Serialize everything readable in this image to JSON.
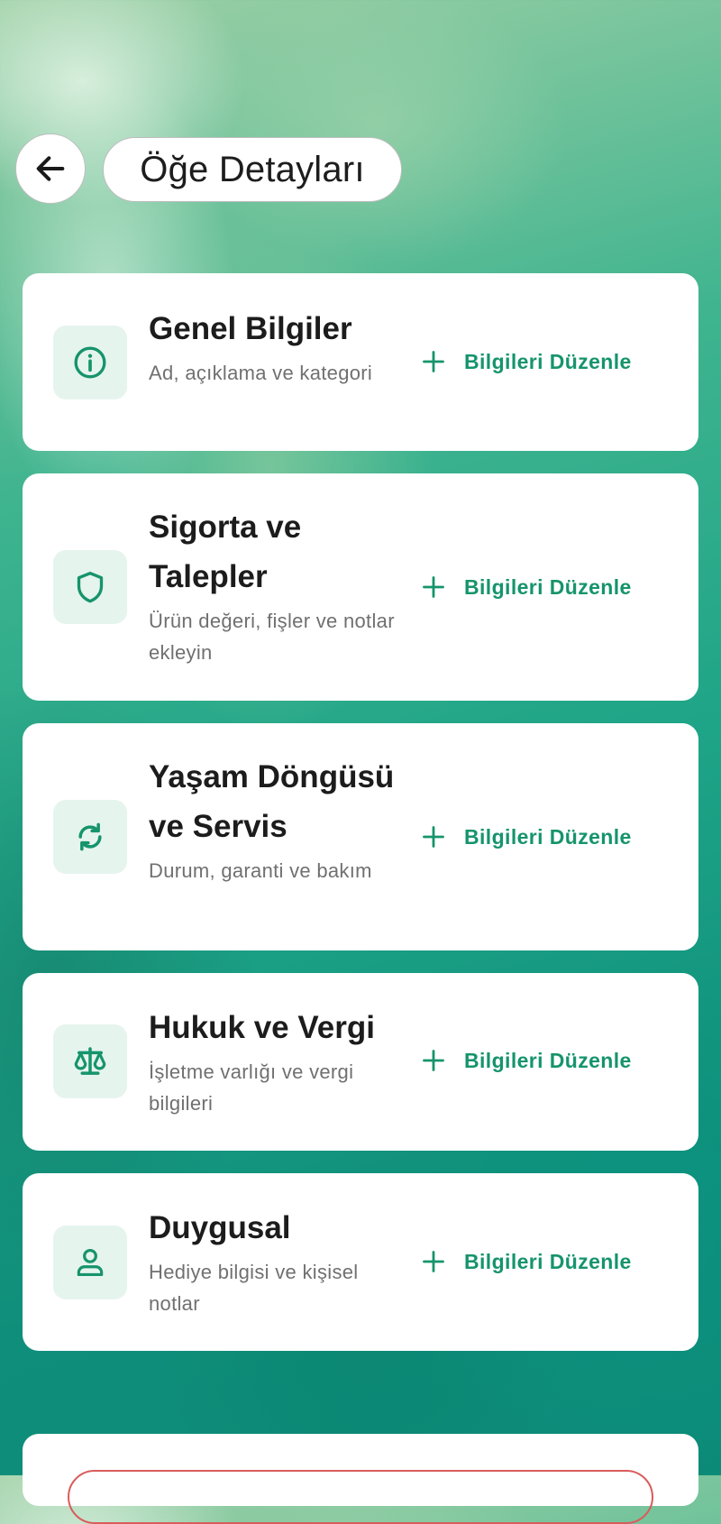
{
  "header": {
    "title": "Öğe Detayları",
    "back_icon": "arrow-left-icon"
  },
  "colors": {
    "accent": "#16946c",
    "icon_bg": "#e6f4ee",
    "danger": "#d95c5c"
  },
  "sections": [
    {
      "title": "Genel Bilgiler",
      "subtitle": "Ad, açıklama ve kategori",
      "icon": "info-icon",
      "action": "Bilgileri Düzenle"
    },
    {
      "title": "Sigorta ve Talepler",
      "subtitle": "Ürün değeri, fişler ve notlar ekleyin",
      "icon": "shield-icon",
      "action": "Bilgileri Düzenle"
    },
    {
      "title": "Yaşam Döngüsü ve Servis",
      "subtitle": "Durum, garanti ve bakım",
      "icon": "refresh-icon",
      "action": "Bilgileri Düzenle"
    },
    {
      "title": "Hukuk ve Vergi",
      "subtitle": "İşletme varlığı ve vergi bilgileri",
      "icon": "scale-icon",
      "action": "Bilgileri Düzenle"
    },
    {
      "title": "Duygusal",
      "subtitle": "Hediye bilgisi ve kişisel notlar",
      "icon": "user-icon",
      "action": "Bilgileri Düzenle"
    }
  ]
}
